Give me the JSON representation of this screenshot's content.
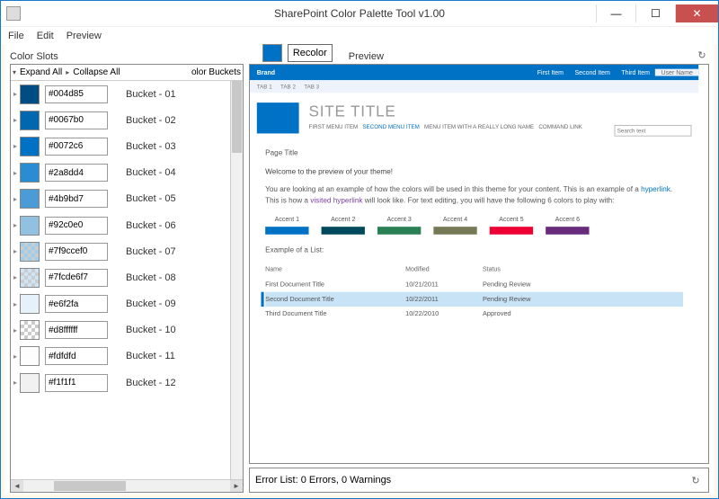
{
  "window": {
    "title": "SharePoint Color Palette Tool v1.00"
  },
  "menu": {
    "file": "File",
    "edit": "Edit",
    "preview": "Preview"
  },
  "top": {
    "color_slots_label": "Color Slots",
    "recolor_label": "Recolor",
    "preview_label": "Preview",
    "recolor_color": "#0072c6"
  },
  "tree_header": {
    "expand_all": "Expand All",
    "collapse_all": "Collapse All",
    "buckets_col": "olor Buckets"
  },
  "slots": [
    {
      "hex": "#004d85",
      "bucket": "Bucket - 01",
      "swatch": "#004d85",
      "checker": false
    },
    {
      "hex": "#0067b0",
      "bucket": "Bucket - 02",
      "swatch": "#0067b0",
      "checker": false
    },
    {
      "hex": "#0072c6",
      "bucket": "Bucket - 03",
      "swatch": "#0072c6",
      "checker": false
    },
    {
      "hex": "#2a8dd4",
      "bucket": "Bucket - 04",
      "swatch": "#2a8dd4",
      "checker": false
    },
    {
      "hex": "#4b9bd7",
      "bucket": "Bucket - 05",
      "swatch": "#4b9bd7",
      "checker": false
    },
    {
      "hex": "#92c0e0",
      "bucket": "Bucket - 06",
      "swatch": "#92c0e0",
      "checker": false
    },
    {
      "hex": "#7f9ccef0",
      "bucket": "Bucket - 07",
      "swatch": "#9ccef0",
      "checker": true
    },
    {
      "hex": "#7fcde6f7",
      "bucket": "Bucket - 08",
      "swatch": "#cde6f7",
      "checker": true
    },
    {
      "hex": "#e6f2fa",
      "bucket": "Bucket - 09",
      "swatch": "#e6f2fa",
      "checker": false
    },
    {
      "hex": "#d8ffffff",
      "bucket": "Bucket - 10",
      "swatch": "#ffffff",
      "checker": true
    },
    {
      "hex": "#fdfdfd",
      "bucket": "Bucket - 11",
      "swatch": "#fdfdfd",
      "checker": false
    },
    {
      "hex": "#f1f1f1",
      "bucket": "Bucket - 12",
      "swatch": "#f1f1f1",
      "checker": false
    }
  ],
  "preview": {
    "brand": "Brand",
    "nav_items": [
      "First Item",
      "Second Item",
      "Third Item"
    ],
    "user": "User Name",
    "tabs": [
      "TAB 1",
      "TAB 2",
      "TAB 3"
    ],
    "site_title": "SITE TITLE",
    "menu_items": {
      "m1": "FIRST MENU ITEM",
      "m2": "SECOND MENU ITEM",
      "m3": "MENU ITEM WITH A REALLY LONG NAME",
      "m4": "COMMAND LINK"
    },
    "search_placeholder": "Search text",
    "page_title": "Page Title",
    "welcome": "Welcome to the preview of your theme!",
    "para1a": "You are looking at an example of how the colors will be used in this theme for your content. This is an example of a ",
    "hyperlink_text": "hyperlink",
    "para1b": ". This is how a ",
    "visited_text": "visited hyperlink",
    "para1c": " will look like. For text editing, you will have the following 6 colors to play with:",
    "accents": [
      {
        "label": "Accent 1",
        "color": "#0072c6"
      },
      {
        "label": "Accent 2",
        "color": "#00485b"
      },
      {
        "label": "Accent 3",
        "color": "#288054"
      },
      {
        "label": "Accent 4",
        "color": "#767956"
      },
      {
        "label": "Accent 5",
        "color": "#ed0033"
      },
      {
        "label": "Accent 6",
        "color": "#682a7a"
      }
    ],
    "list_caption": "Example of a List:",
    "list_headers": {
      "name": "Name",
      "modified": "Modified",
      "status": "Status"
    },
    "list_rows": [
      {
        "name": "First Document Title",
        "modified": "10/21/2011",
        "status": "Pending Review",
        "selected": false
      },
      {
        "name": "Second Document Title",
        "modified": "10/22/2011",
        "status": "Pending Review",
        "selected": true
      },
      {
        "name": "Third Document Title",
        "modified": "10/22/2010",
        "status": "Approved",
        "selected": false
      }
    ]
  },
  "error_list": {
    "text": "Error List: 0 Errors, 0 Warnings"
  }
}
